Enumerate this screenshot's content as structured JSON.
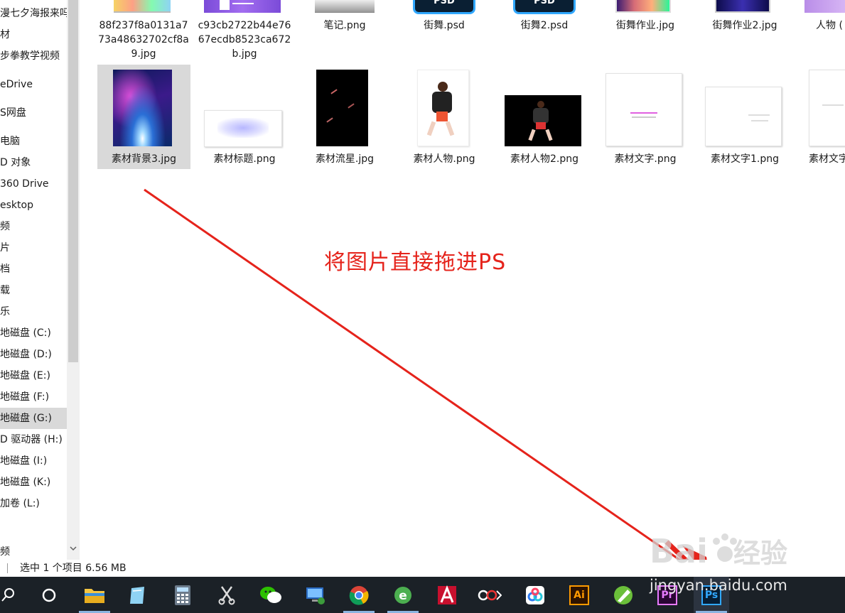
{
  "sidebar": {
    "items": [
      {
        "label": "漫七夕海报来吗"
      },
      {
        "label": "材"
      },
      {
        "label": "步拳教学视频"
      },
      {
        "label": "eDrive"
      },
      {
        "label": "S网盘"
      },
      {
        "label": "电脑"
      },
      {
        "label": "D 对象"
      },
      {
        "label": "360 Drive"
      },
      {
        "label": "esktop"
      },
      {
        "label": "频"
      },
      {
        "label": "片"
      },
      {
        "label": "档"
      },
      {
        "label": "载"
      },
      {
        "label": "乐"
      },
      {
        "label": "地磁盘 (C:)"
      },
      {
        "label": "地磁盘 (D:)"
      },
      {
        "label": "地磁盘 (E:)"
      },
      {
        "label": "地磁盘 (F:)"
      },
      {
        "label": "地磁盘 (G:)"
      },
      {
        "label": "D 驱动器 (H:)"
      },
      {
        "label": "地磁盘 (I:)"
      },
      {
        "label": "地磁盘 (K:)"
      },
      {
        "label": "加卷 (L:)"
      },
      {
        "label": "频"
      }
    ],
    "selected_label": "地磁盘 (G:)"
  },
  "scrollbar": {
    "down_arrow": "chevron-down-icon"
  },
  "files_row1": [
    {
      "name": "88f237f8a0131a773a48632702cf8a9.jpg"
    },
    {
      "name": "c93cb2722b44e7667ecdb8523ca672b.jpg"
    },
    {
      "name": "笔记.png"
    },
    {
      "name": "街舞.psd"
    },
    {
      "name": "街舞2.psd"
    },
    {
      "name": "街舞作业.jpg"
    },
    {
      "name": "街舞作业2.jpg"
    },
    {
      "name": "人物 ("
    }
  ],
  "psd_thumb_label": "PSD",
  "files_row2": [
    {
      "name": "素材背景3.jpg"
    },
    {
      "name": "素材标题.png"
    },
    {
      "name": "素材流星.jpg"
    },
    {
      "name": "素材人物.png"
    },
    {
      "name": "素材人物2.png"
    },
    {
      "name": "素材文字.png"
    },
    {
      "name": "素材文字1.png"
    },
    {
      "name": "素材文字"
    }
  ],
  "status": {
    "text": "选中 1 个项目  6.56 MB"
  },
  "annotation": {
    "text": "将图片直接拖进PS",
    "color": "#e5231b"
  },
  "taskbar": {
    "apps": [
      {
        "icon": "search-icon"
      },
      {
        "icon": "cortana-icon"
      },
      {
        "icon": "file-explorer-icon"
      },
      {
        "icon": "notepad-icon"
      },
      {
        "icon": "calculator-icon"
      },
      {
        "icon": "scissors-icon"
      },
      {
        "icon": "wechat-icon"
      },
      {
        "icon": "remote-desktop-icon"
      },
      {
        "icon": "chrome-icon"
      },
      {
        "icon": "browser-e-icon"
      },
      {
        "icon": "autocad-icon"
      },
      {
        "icon": "video-editor-icon"
      },
      {
        "icon": "baidu-netdisk-icon"
      },
      {
        "icon": "illustrator-icon"
      },
      {
        "icon": "coreldraw-icon"
      },
      {
        "icon": "premiere-icon"
      },
      {
        "icon": "photoshop-icon"
      }
    ],
    "ai_label": "Ai",
    "pr_label": "Pr",
    "ps_label": "Ps"
  },
  "watermark": {
    "brand": "Bai",
    "brand2": "经验",
    "url": "jingyan.baidu.com"
  }
}
